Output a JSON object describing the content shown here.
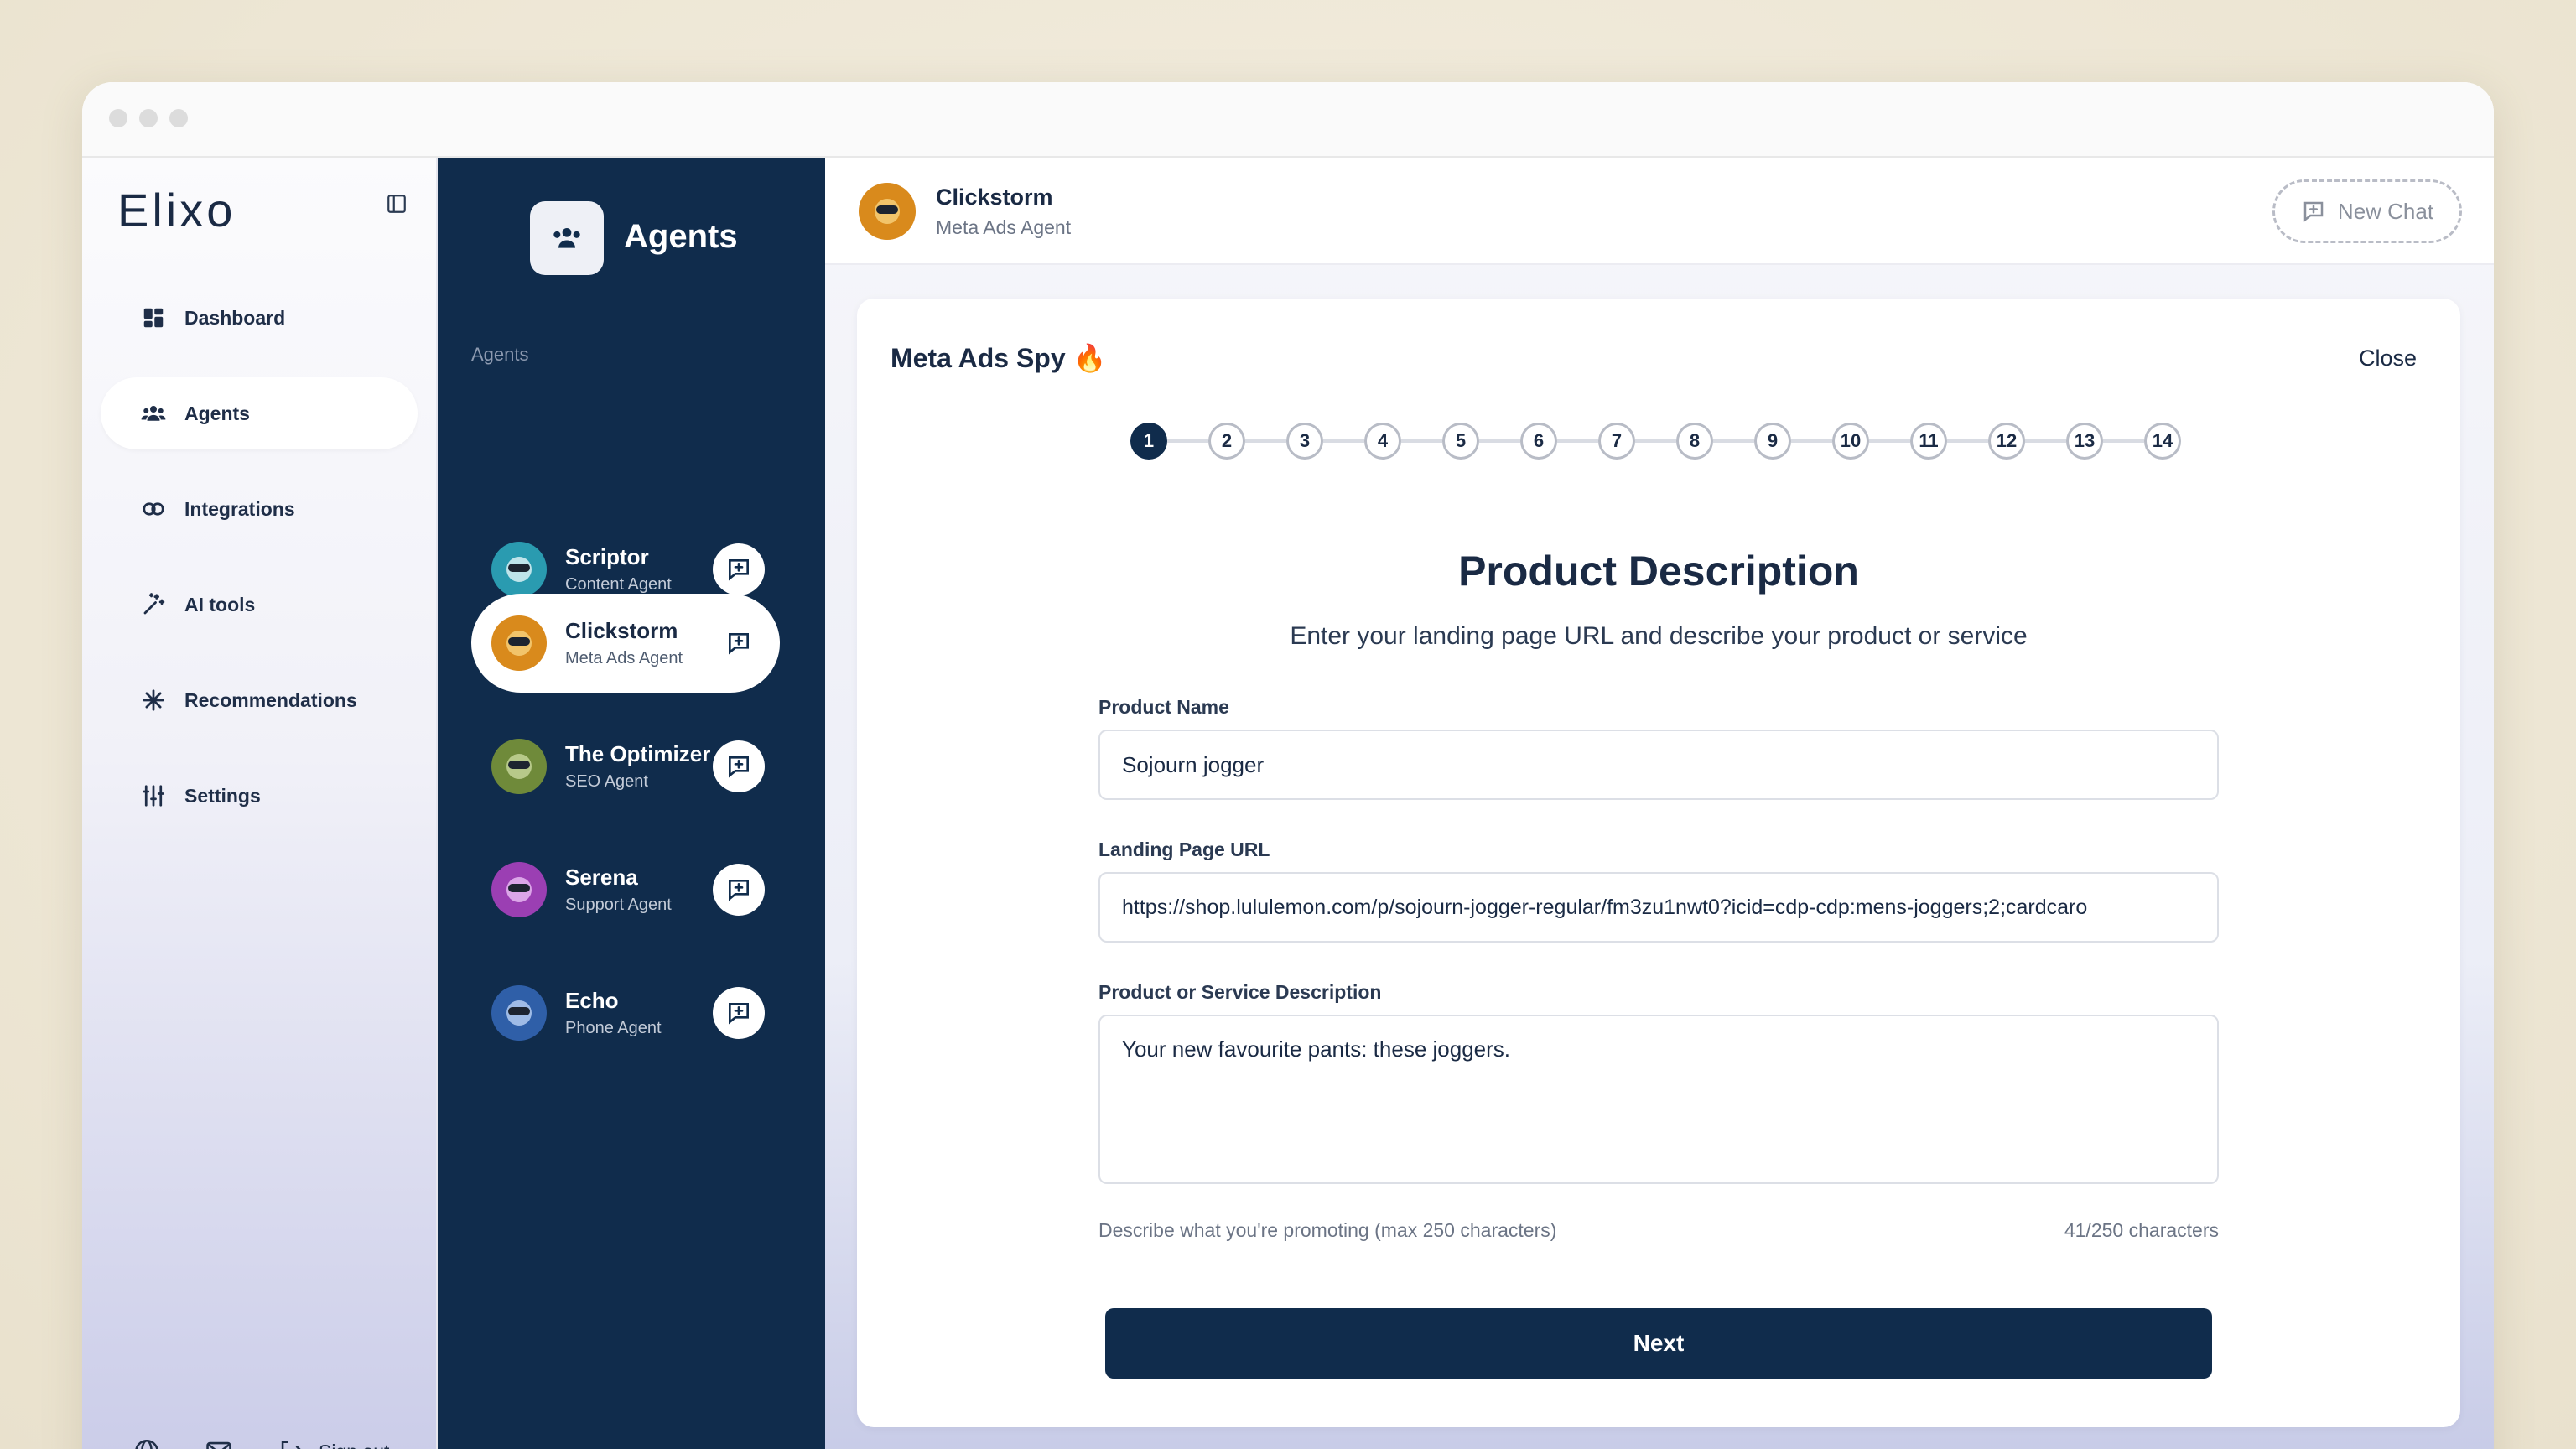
{
  "brand": {
    "logo_text": "Elixo"
  },
  "sidebar": {
    "items": [
      {
        "label": "Dashboard",
        "icon": "dashboard-icon",
        "active": false
      },
      {
        "label": "Agents",
        "icon": "agents-icon",
        "active": true
      },
      {
        "label": "Integrations",
        "icon": "integrations-icon",
        "active": false
      },
      {
        "label": "AI tools",
        "icon": "ai-tools-icon",
        "active": false
      },
      {
        "label": "Recommendations",
        "icon": "recommendations-icon",
        "active": false
      },
      {
        "label": "Settings",
        "icon": "settings-icon",
        "active": false
      }
    ],
    "footer": {
      "signout_label": "Sign out"
    }
  },
  "agents_panel": {
    "title": "Agents",
    "section_label": "Agents",
    "agents": [
      {
        "name": "Scriptor",
        "role": "Content Agent",
        "active": false
      },
      {
        "name": "Clickstorm",
        "role": "Meta Ads Agent",
        "active": true
      },
      {
        "name": "The Optimizer",
        "role": "SEO Agent",
        "active": false
      },
      {
        "name": "Serena",
        "role": "Support Agent",
        "active": false
      },
      {
        "name": "Echo",
        "role": "Phone Agent",
        "active": false
      }
    ]
  },
  "topbar": {
    "agent_name": "Clickstorm",
    "agent_role": "Meta Ads Agent",
    "new_chat_label": "New Chat"
  },
  "card": {
    "title": "Meta Ads Spy 🔥",
    "close_label": "Close",
    "steps": [
      "1",
      "2",
      "3",
      "4",
      "5",
      "6",
      "7",
      "8",
      "9",
      "10",
      "11",
      "12",
      "13",
      "14"
    ],
    "current_step": "1",
    "section_title": "Product Description",
    "section_subtitle": "Enter your landing page URL and describe your product or service",
    "product_name": {
      "label": "Product Name",
      "value": "Sojourn jogger"
    },
    "landing_url": {
      "label": "Landing Page URL",
      "value": "https://shop.lululemon.com/p/sojourn-jogger-regular/fm3zu1nwt0?icid=cdp-cdp:mens-joggers;2;cardcaro"
    },
    "description": {
      "label": "Product or Service Description",
      "value": "Your new favourite pants: these joggers.",
      "hint": "Describe what you're promoting (max 250 characters)",
      "counter": "41/250 characters"
    },
    "next_label": "Next"
  },
  "colors": {
    "navy": "#102c4c",
    "page_bg": "#f1ecde",
    "accent_lavender": "#c9cbe8"
  }
}
